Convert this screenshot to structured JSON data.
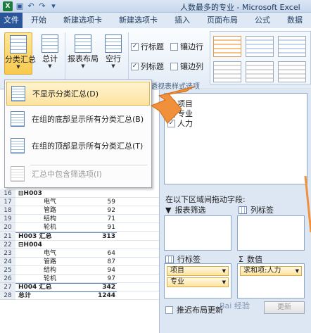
{
  "window": {
    "title": "人数最多的专业 - Microsoft Excel",
    "app_icon": "X"
  },
  "tabs": [
    "文件",
    "开始",
    "新建选项卡",
    "新建选项卡",
    "插入",
    "页面布局",
    "公式",
    "数据"
  ],
  "ribbon": {
    "subtotal_label": "分类汇总",
    "total_label": "总计",
    "report_layout_label": "报表布局",
    "blank_row_label": "空行",
    "checkboxes": {
      "row_headers": "行标题",
      "col_headers": "列标题",
      "banded_rows": "镶边行",
      "banded_cols": "镶边列"
    },
    "group_label": "透视表样式选项"
  },
  "menu": {
    "items": [
      "不显示分类汇总(D)",
      "在组的底部显示所有分类汇总(B)",
      "在组的顶部显示所有分类汇总(T)",
      "汇总中包含筛选项(I)"
    ]
  },
  "sheet": {
    "rows": [
      {
        "num": "16",
        "a": "⊟H003",
        "b": "",
        "c": ""
      },
      {
        "num": "17",
        "a": "",
        "b": "电气",
        "c": "59"
      },
      {
        "num": "18",
        "a": "",
        "b": "管路",
        "c": "92"
      },
      {
        "num": "19",
        "a": "",
        "b": "结构",
        "c": "71"
      },
      {
        "num": "20",
        "a": "",
        "b": "轮机",
        "c": "91"
      },
      {
        "num": "21",
        "a": "H003 汇总",
        "b": "",
        "c": "313"
      },
      {
        "num": "22",
        "a": "⊟H004",
        "b": "",
        "c": ""
      },
      {
        "num": "23",
        "a": "",
        "b": "电气",
        "c": "64"
      },
      {
        "num": "24",
        "a": "",
        "b": "管路",
        "c": "87"
      },
      {
        "num": "25",
        "a": "",
        "b": "结构",
        "c": "94"
      },
      {
        "num": "26",
        "a": "",
        "b": "轮机",
        "c": "97"
      },
      {
        "num": "27",
        "a": "H004 汇总",
        "b": "",
        "c": "342"
      },
      {
        "num": "28",
        "a": "总计",
        "b": "",
        "c": "1244"
      }
    ]
  },
  "field_list": {
    "fields": [
      "项目",
      "专业",
      "人力"
    ],
    "drag_prompt": "在以下区域间拖动字段:",
    "report_filter": "报表筛选",
    "column_labels": "列标签",
    "row_labels": "行标签",
    "values": "数值",
    "row_items": [
      "项目",
      "专业"
    ],
    "value_items": [
      "求和项:人力"
    ],
    "defer_update": "推迟布局更新",
    "update_button": "更新"
  },
  "watermark": "Bai 经验"
}
